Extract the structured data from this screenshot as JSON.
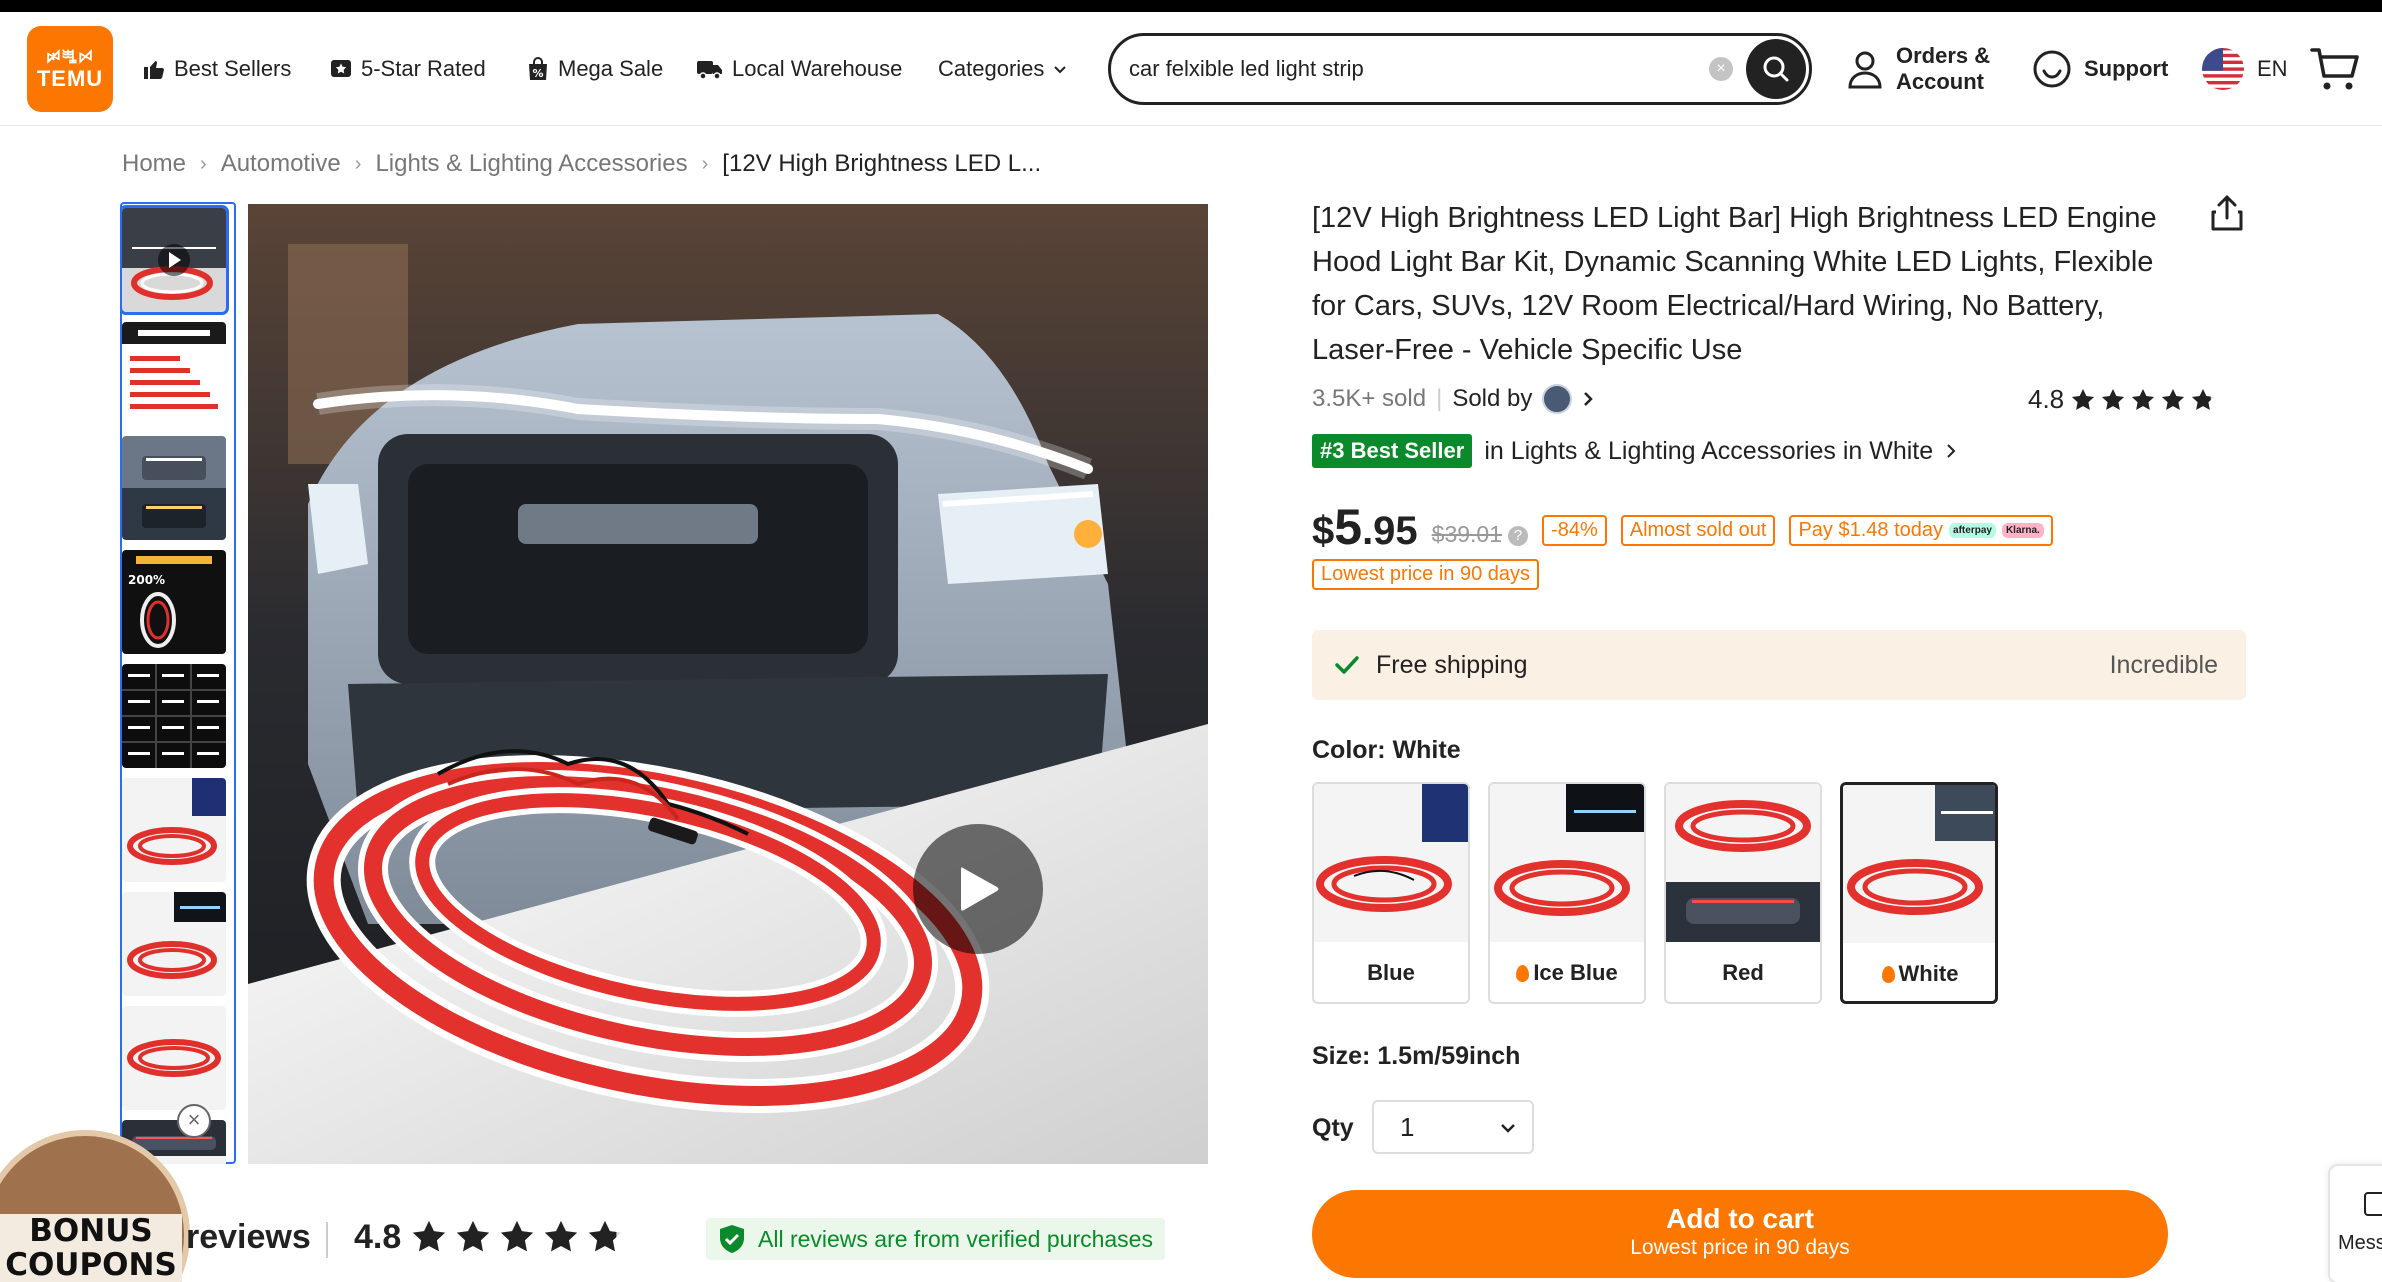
{
  "header": {
    "logo_top": "ꗰꗀꗯ",
    "logo_bottom": "TEMU",
    "nav": {
      "best_sellers": "Best Sellers",
      "five_star": "5-Star Rated",
      "mega_sale": "Mega Sale",
      "local_warehouse": "Local Warehouse",
      "categories": "Categories"
    },
    "search": {
      "value": "car felxible led light strip"
    },
    "orders_line1": "Orders &",
    "orders_line2": "Account",
    "support": "Support",
    "language": "EN"
  },
  "breadcrumb": {
    "items": [
      "Home",
      "Automotive",
      "Lights & Lighting Accessories",
      "[12V High Brightness LED L..."
    ]
  },
  "gallery": {
    "thumb_count": 9,
    "selected_index": 0
  },
  "bonus": {
    "line1": "BONUS",
    "line2": "COUPONS"
  },
  "reviews": {
    "label": "reviews",
    "score": "4.8",
    "stars": 4.8,
    "verified": "All reviews are from verified purchases"
  },
  "product": {
    "title": "[12V High Brightness LED Light Bar] High Brightness LED Engine Hood Light Bar Kit, Dynamic Scanning White LED Lights, Flexible for Cars, SUVs, 12V Room Electrical/Hard Wiring, No Battery, Laser-Free - Vehicle Specific Use",
    "sold": "3.5K+ sold",
    "sold_by": "Sold by",
    "rating": "4.8",
    "rating_stars": 4.8,
    "best_seller_badge": "#3 Best Seller",
    "best_seller_text": "in Lights & Lighting Accessories in White",
    "price_currency": "$",
    "price_whole": "5",
    "price_cents": ".95",
    "old_price": "$39.01",
    "discount": "-84%",
    "almost_sold_out": "Almost sold out",
    "pay_today": "Pay $1.48 today",
    "afterpay": "afterpay",
    "klarna": "Klarna.",
    "lowest_price": "Lowest price in 90 days",
    "shipping": "Free shipping",
    "shipping_right": "Incredible",
    "color_label": "Color:",
    "color_value": "White",
    "colors": [
      {
        "name": "Blue",
        "hot": false
      },
      {
        "name": "Ice Blue",
        "hot": true
      },
      {
        "name": "Red",
        "hot": false
      },
      {
        "name": "White",
        "hot": true
      }
    ],
    "size_label": "Size:",
    "size_value": "1.5m/59inch",
    "qty_label": "Qty",
    "qty_value": "1",
    "add_to_cart": "Add to cart",
    "add_to_cart_sub": "Lowest price in 90 days"
  },
  "side": {
    "messages": "Mess"
  },
  "colors": {
    "brand": "#fb7701",
    "best_seller_green": "#0a8a2a",
    "link_blue": "#2a6df4"
  }
}
